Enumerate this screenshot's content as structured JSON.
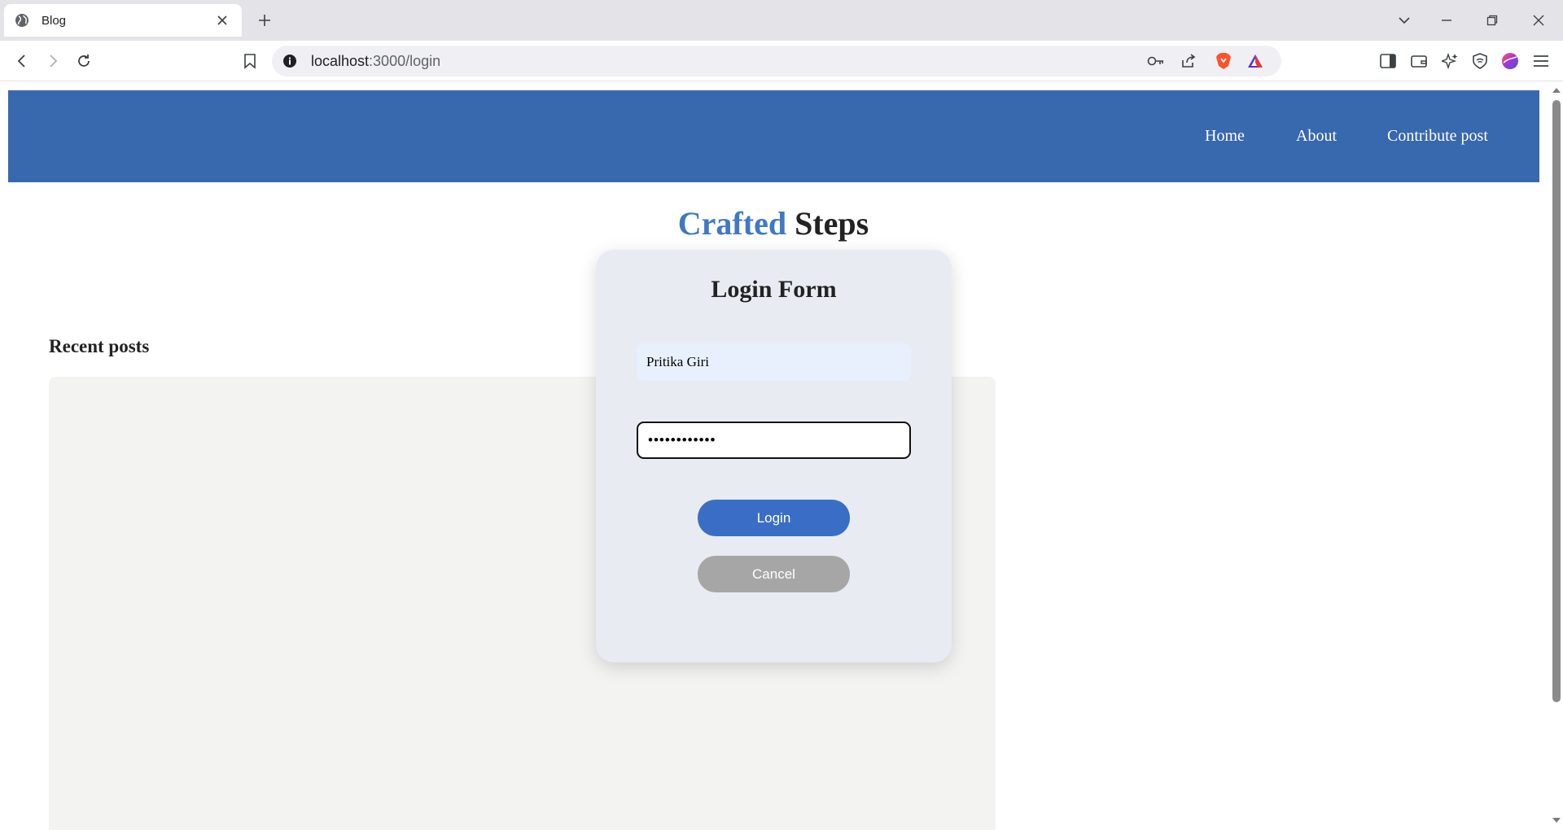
{
  "browser": {
    "tab_title": "Blog",
    "url_host": "localhost",
    "url_path": ":3000/login"
  },
  "site": {
    "nav": [
      "Home",
      "About",
      "Contribute post"
    ],
    "brand_accent": "Crafted",
    "brand_rest": " Steps",
    "recent_posts_title": "Recent posts"
  },
  "login_form": {
    "title": "Login Form",
    "username_value": "Pritika Giri",
    "password_value": "••••••••••••",
    "login_label": "Login",
    "cancel_label": "Cancel"
  },
  "colors": {
    "header": "#3868ae",
    "accent": "#3f79c3",
    "login_button": "#3a6ec6",
    "cancel_button": "#a6a6a6",
    "card": "#e8ecf2"
  }
}
